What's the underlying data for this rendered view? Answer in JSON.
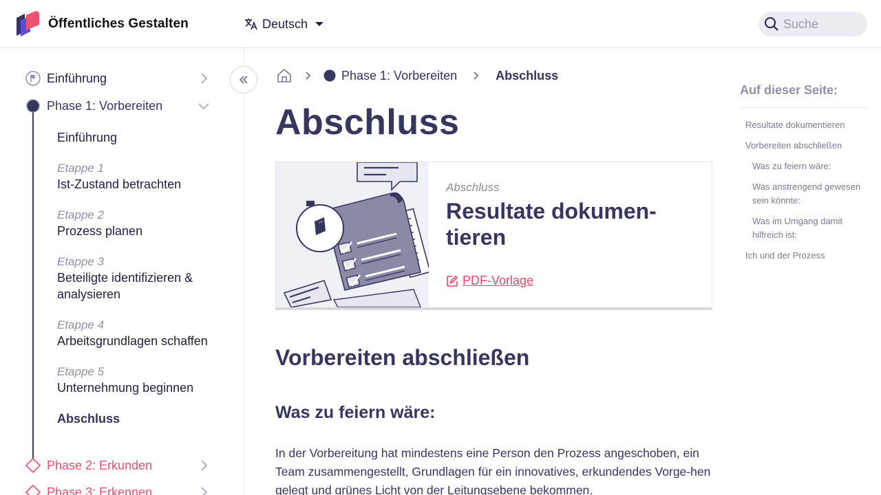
{
  "header": {
    "brand": "Öffentliches Gestalten",
    "language": "Deutsch",
    "search_placeholder": "Suche",
    "logo_icon": "brand-logo-icon",
    "colors": {
      "brand_pink": "#f0516f",
      "brand_navy": "#36365f",
      "brand_violet": "#5b4bd6"
    }
  },
  "sidebar": {
    "phases": [
      {
        "label": "Einführung",
        "state": "default",
        "icon": "flag-icon",
        "chevron": "chevron-right-icon"
      },
      {
        "label": "Phase 1: Vorbereiten",
        "state": "active",
        "icon": "filled-circle-icon",
        "chevron": "chevron-down-icon"
      },
      {
        "label": "Phase 2: Erkunden",
        "state": "upcoming",
        "icon": "diamond-icon",
        "chevron": "chevron-right-icon"
      },
      {
        "label": "Phase 3: Erkennen",
        "state": "upcoming",
        "icon": "diamond-icon",
        "chevron": "chevron-right-icon"
      }
    ],
    "subitems": [
      {
        "step": "",
        "title": "Einführung"
      },
      {
        "step": "Etappe 1",
        "title": "Ist-Zustand betrachten"
      },
      {
        "step": "Etappe 2",
        "title": "Prozess planen"
      },
      {
        "step": "Etappe 3",
        "title": "Beteiligte identifizieren & analysieren"
      },
      {
        "step": "Etappe 4",
        "title": "Arbeitsgrundlagen schaffen"
      },
      {
        "step": "Etappe 5",
        "title": "Unternehmung beginnen"
      },
      {
        "step": "",
        "title": "Abschluss"
      }
    ],
    "colors": {
      "active": "#36365f",
      "upcoming": "#e8506f",
      "muted": "#9090a8"
    }
  },
  "breadcrumb": {
    "phase": "Phase 1: Vorbereiten",
    "current": "Abschluss"
  },
  "main": {
    "title": "Abschluss",
    "card": {
      "kicker": "Abschluss",
      "title": "Resultate dokumen-tieren",
      "link": "PDF-Vorlage"
    },
    "h2": "Vorbereiten abschließen",
    "h3": "Was zu feiern wäre:",
    "paragraph": "In der Vorbereitung hat mindestens eine Person den Prozess angeschoben, ein Team zusammengestellt, Grundlagen für ein innovatives, erkundendes Vorge-hen gelegt und grünes Licht von der Leitungsebene bekommen."
  },
  "toc": {
    "heading": "Auf dieser Seite:",
    "items": [
      {
        "label": "Resultate dokumentieren",
        "level": 1
      },
      {
        "label": "Vorbereiten abschließen",
        "level": 1
      },
      {
        "label": "Was zu feiern wäre:",
        "level": 2
      },
      {
        "label": "Was anstrengend gewesen sein könnte:",
        "level": 2
      },
      {
        "label": "Was im Umgang damit hilfreich ist:",
        "level": 2
      },
      {
        "label": "Ich und der Prozess",
        "level": 1
      }
    ]
  }
}
